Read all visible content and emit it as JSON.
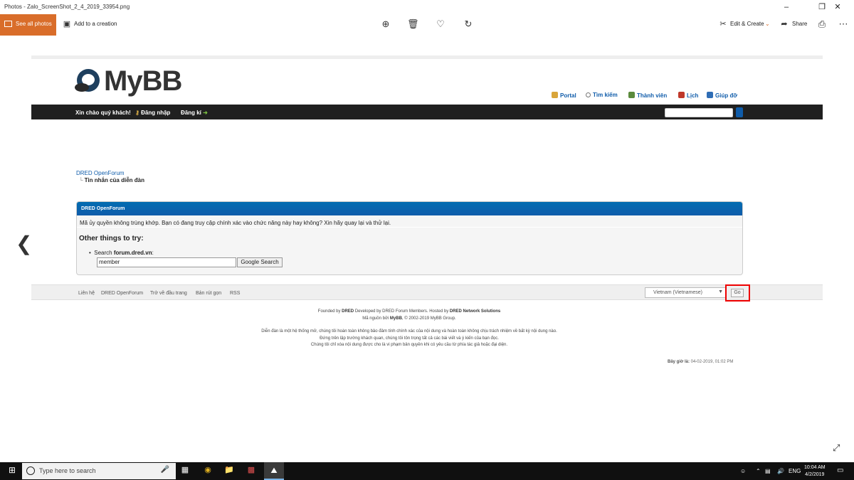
{
  "window": {
    "title": "Photos - Zalo_ScreenShot_2_4_2019_33954.png",
    "minimize_icon": "minimize-icon",
    "maximize_icon": "restore-icon",
    "close_icon": "close-icon"
  },
  "toolbar": {
    "see_all": "See all photos",
    "add_creation": "Add to a creation",
    "edit_create": "Edit & Create",
    "share": "Share"
  },
  "forum": {
    "logo_text": "MyBB",
    "menu": [
      {
        "label": "Portal"
      },
      {
        "label": "Tìm kiếm"
      },
      {
        "label": "Thành viên"
      },
      {
        "label": "Lịch"
      },
      {
        "label": "Giúp đỡ"
      }
    ],
    "welcome": "Xin chào quý khách!",
    "login": "Đăng nhập",
    "register": "Đăng kí",
    "breadcrumb_root": "DRED OpenForum",
    "breadcrumb_current": "Tin nhắn của diễn đàn",
    "box_title": "DRED OpenForum",
    "message": "Mã ủy quyền không trùng khớp. Bạn có đang truy cập chính xác vào chức năng này hay không? Xin hãy quay lại và thử lại.",
    "other_heading": "Other things to try:",
    "search_label_prefix": "Search ",
    "search_site": "forum.dred.vn",
    "search_label_suffix": ":",
    "search_value": "member",
    "google_button": "Google Search",
    "footer_links": [
      {
        "label": "Liên hệ"
      },
      {
        "label": "DRED OpenForum"
      },
      {
        "label": "Trở về đầu trang"
      },
      {
        "label": "Bản rút gọn"
      },
      {
        "label": "RSS"
      }
    ],
    "language_selected": "Vietnam (Vietnamese)",
    "go_button": "Go",
    "credits_1a": "Founded by ",
    "credits_1b": "DRED",
    "credits_1c": " Developed by DRED Forum Members. Hosted by ",
    "credits_1d": "DRED Network Solutions",
    "credits_2a": "Mã nguồn bởi ",
    "credits_2b": "MyBB",
    "credits_2c": ", © 2002-2019 MyBB Group.",
    "disclaimer_1": "Diễn đàn là một hệ thống mở, chúng tôi hoàn toàn không bảo đảm tính chính xác của nội dung và hoàn toàn không chịu trách nhiệm về bất kỳ nội dung nào.",
    "disclaimer_2": "Đứng trên lập trường khách quan, chúng tôi tôn trọng tất cả các bài viết và ý kiến của bạn đọc.",
    "disclaimer_3": "Chúng tôi chỉ xóa nội dung được cho là vi phạm bản quyền khi có yêu cầu từ phía tác giả hoặc đại diện.",
    "time_label": "Bây giờ là:",
    "time_value": "04-02-2019, 01:02 PM"
  },
  "taskbar": {
    "search_placeholder": "Type here to search",
    "lang": "ENG",
    "time": "10:04 AM",
    "date": "4/2/2019"
  },
  "colors": {
    "accent_orange": "#d96d2a",
    "mybb_blue": "#0f5caa",
    "panel_dark": "#202020",
    "highlight_red": "#e00000"
  }
}
